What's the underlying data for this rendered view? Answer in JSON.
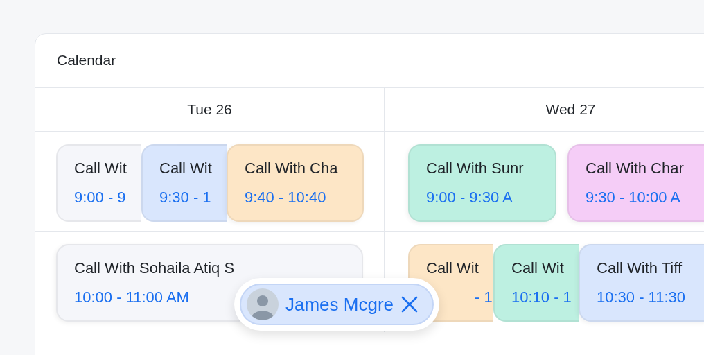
{
  "panel": {
    "title": "Calendar"
  },
  "days": [
    {
      "label": "Tue 26"
    },
    {
      "label": "Wed 27"
    }
  ],
  "rows": [
    {
      "cells": [
        {
          "events": [
            {
              "title": "Call Wit",
              "time": "9:00 - 9",
              "color": "#f5f6fa"
            },
            {
              "title": "Call Wit",
              "time": "9:30 - 1",
              "color": "#d9e6fd"
            },
            {
              "title": "Call With Cha",
              "time": "9:40 - 10:40",
              "color": "#fde6c6"
            }
          ]
        },
        {
          "events": [
            {
              "title": "Call With Sunr",
              "time": "9:00 - 9:30 A",
              "color": "#bdf0e1"
            },
            {
              "title": "Call With Char",
              "time": "9:30 - 10:00 A",
              "color": "#f5cdf7"
            }
          ]
        }
      ]
    },
    {
      "cells": [
        {
          "events": [
            {
              "title": "Call With Sohaila Atiq S",
              "time": "10:00 - 11:00 AM",
              "color": "#f5f6fa"
            }
          ]
        },
        {
          "events": [
            {
              "title": "Call Wit",
              "time": "- 1",
              "color": "#fde6c6"
            },
            {
              "title": "Call Wit",
              "time": "10:10 - 1",
              "color": "#bdf0e1"
            },
            {
              "title": "Call With Tiff",
              "time": "10:30 - 11:30",
              "color": "#d9e6fd"
            }
          ]
        }
      ]
    }
  ],
  "chip": {
    "name": "James Mcgre"
  }
}
